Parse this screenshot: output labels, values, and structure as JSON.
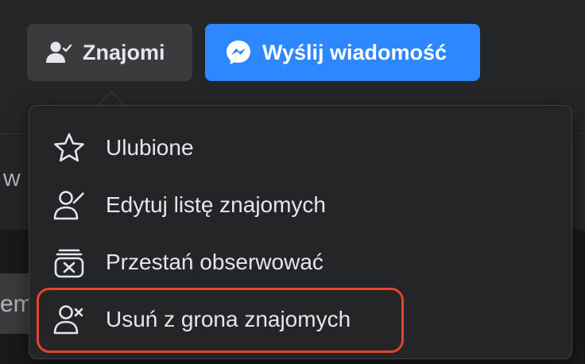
{
  "background": {
    "partial_text_1": "w",
    "partial_text_2": "em"
  },
  "actions": {
    "friends_label": "Znajomi",
    "friends_icon": "user-check-icon",
    "message_label": "Wyślij wiadomość",
    "message_icon": "messenger-icon"
  },
  "menu": {
    "items": [
      {
        "label": "Ulubione",
        "icon": "star-icon"
      },
      {
        "label": "Edytuj listę znajomych",
        "icon": "user-edit-icon"
      },
      {
        "label": "Przestań obserwować",
        "icon": "unfollow-icon"
      },
      {
        "label": "Usuń z grona znajomych",
        "icon": "user-remove-icon",
        "highlighted": true
      }
    ]
  },
  "colors": {
    "background": "#18191a",
    "surface": "#242526",
    "button_secondary": "#3a3b3c",
    "primary": "#2d88ff",
    "text": "#e4e6eb",
    "highlight": "#e0452e"
  }
}
